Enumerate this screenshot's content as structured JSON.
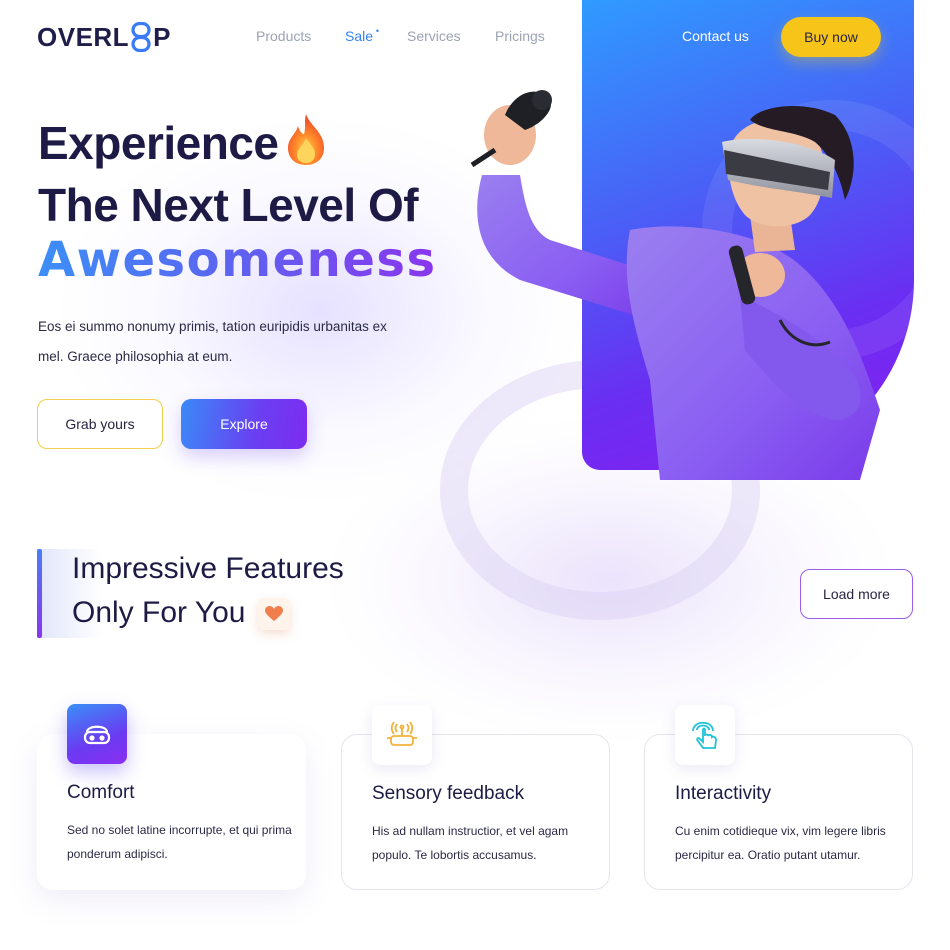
{
  "header": {
    "logo_part1": "OVERL",
    "logo_part2": "P",
    "nav": [
      {
        "label": "Products"
      },
      {
        "label": "Sale",
        "marker": "•"
      },
      {
        "label": "Services"
      },
      {
        "label": "Pricings"
      }
    ],
    "contact_label": "Contact us",
    "buy_label": "Buy now"
  },
  "hero": {
    "line1": "Experience",
    "line2": "The Next Level Of",
    "highlight": "Awesomeness",
    "description": "Eos ei summo nonumy primis, tation euripidis urbanitas ex mel. Graece philosophia at eum.",
    "grab_label": "Grab yours",
    "explore_label": "Explore",
    "icons": [
      "fire-emoji",
      "vr-person-image"
    ]
  },
  "features": {
    "line1": "Impressive Features",
    "line2": "Only For You",
    "load_more_label": "Load more",
    "cards": [
      {
        "icon": "vr-headset-icon",
        "title": "Comfort",
        "description": "Sed no solet latine incorrupte, et qui prima ponderum adipisci."
      },
      {
        "icon": "sensory-headset-icon",
        "title": "Sensory feedback",
        "description": "His ad nullam instructior, et vel agam populo. Te lobortis accusamus."
      },
      {
        "icon": "touch-hand-icon",
        "title": "Interactivity",
        "description": "Cu enim cotidieque vix, vim legere libris percipitur ea. Oratio putant utamur."
      }
    ]
  },
  "colors": {
    "brand_dark": "#1d1b45",
    "accent_blue": "#3583f5",
    "accent_purple": "#7d2cf0",
    "accent_yellow": "#f7c51a"
  }
}
